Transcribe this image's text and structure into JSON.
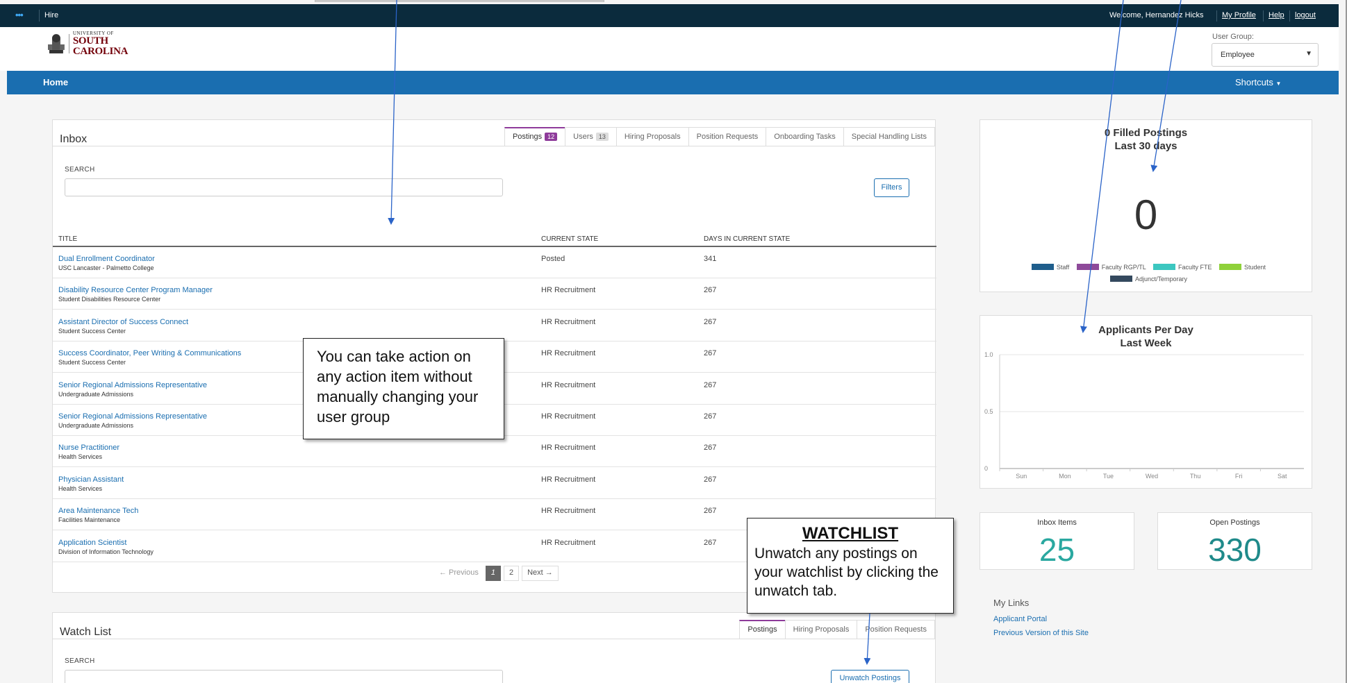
{
  "topbar": {
    "app_name": "Hire",
    "welcome": "Welcome, Hernandez Hicks",
    "my_profile": "My Profile",
    "help": "Help",
    "logout": "logout"
  },
  "logo": {
    "line1": "UNIVERSITY OF",
    "line2": "SOUTH CAROLINA"
  },
  "user_group": {
    "label": "User Group:",
    "value": "Employee"
  },
  "nav": {
    "home": "Home",
    "shortcuts": "Shortcuts"
  },
  "inbox": {
    "title": "Inbox",
    "tabs": [
      {
        "label": "Postings",
        "badge": "12"
      },
      {
        "label": "Users",
        "badge": "13"
      },
      {
        "label": "Hiring Proposals"
      },
      {
        "label": "Position Requests"
      },
      {
        "label": "Onboarding Tasks"
      },
      {
        "label": "Special Handling Lists"
      }
    ],
    "search_label": "SEARCH",
    "filters": "Filters",
    "columns": [
      "TITLE",
      "CURRENT STATE",
      "DAYS IN CURRENT STATE"
    ],
    "rows": [
      {
        "title": "Dual Enrollment Coordinator",
        "dept": "USC Lancaster - Palmetto College",
        "state": "Posted",
        "days": "341"
      },
      {
        "title": "Disability Resource Center Program Manager",
        "dept": "Student Disabilities Resource Center",
        "state": "HR Recruitment",
        "days": "267"
      },
      {
        "title": "Assistant Director of Success Connect",
        "dept": "Student Success Center",
        "state": "HR Recruitment",
        "days": "267"
      },
      {
        "title": "Success Coordinator, Peer Writing & Communications",
        "dept": "Student Success Center",
        "state": "HR Recruitment",
        "days": "267"
      },
      {
        "title": "Senior Regional Admissions Representative",
        "dept": "Undergraduate Admissions",
        "state": "HR Recruitment",
        "days": "267"
      },
      {
        "title": "Senior Regional Admissions Representative",
        "dept": "Undergraduate Admissions",
        "state": "HR Recruitment",
        "days": "267"
      },
      {
        "title": "Nurse Practitioner",
        "dept": "Health Services",
        "state": "HR Recruitment",
        "days": "267"
      },
      {
        "title": "Physician Assistant",
        "dept": "Health Services",
        "state": "HR Recruitment",
        "days": "267"
      },
      {
        "title": "Area Maintenance Tech",
        "dept": "Facilities Maintenance",
        "state": "HR Recruitment",
        "days": "267"
      },
      {
        "title": "Application Scientist",
        "dept": "Division of Information Technology",
        "state": "HR Recruitment",
        "days": "267"
      }
    ],
    "pagination": {
      "previous": "← Previous",
      "pages": [
        "1",
        "2"
      ],
      "next": "Next →",
      "current": "1"
    }
  },
  "watch_list": {
    "title": "Watch List",
    "tabs": [
      "Postings",
      "Hiring Proposals",
      "Position Requests"
    ],
    "search_label": "SEARCH",
    "unwatch": "Unwatch Postings"
  },
  "filled_postings": {
    "title_line1": "0 Filled Postings",
    "title_line2": "Last 30 days",
    "value": "0",
    "legend": [
      {
        "name": "Staff",
        "color": "#1f5e8c"
      },
      {
        "name": "Faculty RGP/TL",
        "color": "#8e4a9a"
      },
      {
        "name": "Faculty FTE",
        "color": "#3cc7c0"
      },
      {
        "name": "Student",
        "color": "#8fd13a"
      },
      {
        "name": "Adjunct/Temporary",
        "color": "#34495e"
      }
    ]
  },
  "applicants_chart": {
    "title_line1": "Applicants Per Day",
    "title_line2": "Last Week"
  },
  "chart_data": {
    "type": "line",
    "title": "Applicants Per Day Last Week",
    "categories": [
      "Sun",
      "Mon",
      "Tue",
      "Wed",
      "Thu",
      "Fri",
      "Sat"
    ],
    "values": [
      0,
      0,
      0,
      0,
      0,
      0,
      0
    ],
    "yticks": [
      "0",
      "0.5",
      "1.0"
    ],
    "ylim": [
      0,
      1.0
    ],
    "grid": true
  },
  "stats": {
    "inbox_label": "Inbox Items",
    "inbox_value": "25",
    "open_label": "Open Postings",
    "open_value": "330"
  },
  "my_links": {
    "title": "My Links",
    "items": [
      "Applicant Portal",
      "Previous Version of this Site"
    ]
  },
  "annotations": {
    "callout1": "You can take action on any action item without manually changing your user group",
    "callout2_title": "WATCHLIST",
    "callout2_body": "Unwatch any postings on your watchlist by clicking the unwatch tab."
  },
  "colors": {
    "nav_blue": "#1a6eb0",
    "topbar": "#0b2b3d",
    "accent_purple": "#8e3b9a",
    "stat_teal": "#2aa8a0"
  }
}
